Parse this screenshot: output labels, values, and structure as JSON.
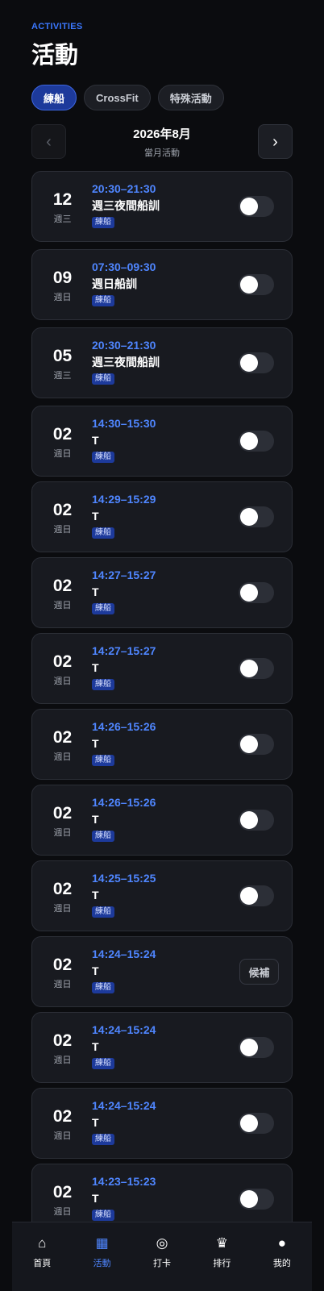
{
  "header": {
    "eyebrow": "ACTIVITIES",
    "title": "活動"
  },
  "tabs": [
    {
      "label": "練船",
      "active": true
    },
    {
      "label": "CrossFit",
      "active": false
    },
    {
      "label": "特殊活動",
      "active": false
    }
  ],
  "month_nav": {
    "prev": "‹",
    "next": "›",
    "title": "2026年8月",
    "subtitle": "當月活動"
  },
  "activities": [
    {
      "day": "12",
      "weekday": "週三",
      "time": "20:30–21:30",
      "name": "週三夜間船訓",
      "tag": "練船",
      "action": "toggle"
    },
    {
      "day": "09",
      "weekday": "週日",
      "time": "07:30–09:30",
      "name": "週日船訓",
      "tag": "練船",
      "action": "toggle"
    },
    {
      "day": "05",
      "weekday": "週三",
      "time": "20:30–21:30",
      "name": "週三夜間船訓",
      "tag": "練船",
      "action": "toggle"
    },
    {
      "day": "02",
      "weekday": "週日",
      "time": "14:30–15:30",
      "name": "T",
      "tag": "練船",
      "action": "toggle"
    },
    {
      "day": "02",
      "weekday": "週日",
      "time": "14:29–15:29",
      "name": "T",
      "tag": "練船",
      "action": "toggle"
    },
    {
      "day": "02",
      "weekday": "週日",
      "time": "14:27–15:27",
      "name": "T",
      "tag": "練船",
      "action": "toggle"
    },
    {
      "day": "02",
      "weekday": "週日",
      "time": "14:27–15:27",
      "name": "T",
      "tag": "練船",
      "action": "toggle"
    },
    {
      "day": "02",
      "weekday": "週日",
      "time": "14:26–15:26",
      "name": "T",
      "tag": "練船",
      "action": "toggle"
    },
    {
      "day": "02",
      "weekday": "週日",
      "time": "14:26–15:26",
      "name": "T",
      "tag": "練船",
      "action": "toggle"
    },
    {
      "day": "02",
      "weekday": "週日",
      "time": "14:25–15:25",
      "name": "T",
      "tag": "練船",
      "action": "toggle"
    },
    {
      "day": "02",
      "weekday": "週日",
      "time": "14:24–15:24",
      "name": "T",
      "tag": "練船",
      "action": "waitlist",
      "action_label": "候補"
    },
    {
      "day": "02",
      "weekday": "週日",
      "time": "14:24–15:24",
      "name": "T",
      "tag": "練船",
      "action": "toggle"
    },
    {
      "day": "02",
      "weekday": "週日",
      "time": "14:24–15:24",
      "name": "T",
      "tag": "練船",
      "action": "toggle"
    },
    {
      "day": "02",
      "weekday": "週日",
      "time": "14:23–15:23",
      "name": "T",
      "tag": "練船",
      "action": "toggle"
    }
  ],
  "bottom_nav": [
    {
      "icon": "⌂",
      "icon_name": "home-icon",
      "label": "首頁",
      "active": false
    },
    {
      "icon": "▦",
      "icon_name": "calendar-icon",
      "label": "活動",
      "active": true
    },
    {
      "icon": "◎",
      "icon_name": "checkin-icon",
      "label": "打卡",
      "active": false
    },
    {
      "icon": "♛",
      "icon_name": "crown-icon",
      "label": "排行",
      "active": false
    },
    {
      "icon": "●",
      "icon_name": "avatar-icon",
      "label": "我的",
      "active": false
    }
  ],
  "colors": {
    "accent": "#3b78ff",
    "tag_bg": "#1d3a9b",
    "background": "#0b0c0f",
    "card": "#181a20"
  }
}
